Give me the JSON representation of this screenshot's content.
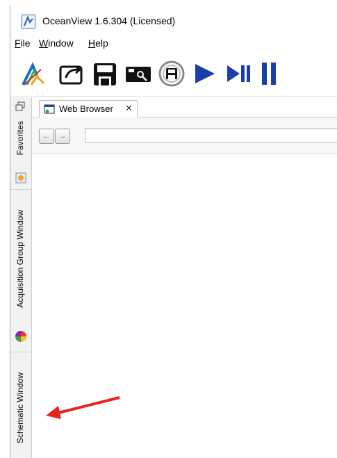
{
  "window": {
    "title": "OceanView 1.6.304 (Licensed)"
  },
  "menu": [
    {
      "label": "File",
      "mnemonic": "F",
      "rest": "ile"
    },
    {
      "label": "Window",
      "mnemonic": "W",
      "rest": "indow"
    },
    {
      "label": "Help",
      "mnemonic": "H",
      "rest": "elp"
    }
  ],
  "toolbar": {
    "icons": [
      "oceanview-logo-icon",
      "open-icon",
      "save-icon",
      "camera-icon",
      "save-all-icon",
      "play-icon",
      "play-pause-icon",
      "pause-icon"
    ],
    "accent": "#1a3fa8"
  },
  "dock": {
    "tabs": [
      {
        "label": "Favorites",
        "icon": "favorites-icon"
      },
      {
        "label": "Acquisition Group Window",
        "icon": "acquisition-color-wheel-icon"
      },
      {
        "label": "Schematic Window",
        "icon": ""
      }
    ]
  },
  "browser": {
    "tab_label": "Web Browser",
    "close_glyph": "✕",
    "back_glyph": "←",
    "forward_glyph": "→",
    "url_value": "",
    "url_placeholder": ""
  },
  "annotation": {
    "color": "#e8231a",
    "target": "Schematic Window"
  }
}
